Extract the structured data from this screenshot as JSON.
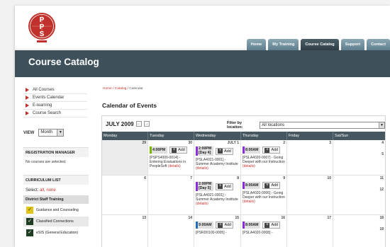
{
  "colors": {
    "accent_red": "#c0312b",
    "header_dark": "#3e515a",
    "nav_blue": "#6f8e9c",
    "green_marker": "#7ab800",
    "purple_marker": "#8a2be2",
    "blue_marker": "#1e6fb5"
  },
  "logo": {
    "letters": [
      "P",
      "P",
      "S"
    ]
  },
  "nav": {
    "tabs": [
      {
        "label": "Home",
        "active": false
      },
      {
        "label": "My Training",
        "active": false
      },
      {
        "label": "Course Catalog",
        "active": true
      },
      {
        "label": "Support",
        "active": false
      },
      {
        "label": "Contact",
        "active": false
      }
    ]
  },
  "page_title": "Course Catalog",
  "sidebar": {
    "menu": [
      "All Courses",
      "Events Calendar",
      "E-learning",
      "Course Search"
    ],
    "view_label": "VIEW",
    "view_value": "Month",
    "registration": {
      "title": "REGISTRATION MANAGER",
      "text": "No courses are selected."
    },
    "curriculum": {
      "title": "CURRICULUM LIST",
      "select_label": "Select:",
      "all": "all",
      "none": "none"
    },
    "group": "District Staff Training",
    "items": [
      "Guidance and Counseling",
      "Classified Connections",
      "eSIS (General Education)"
    ]
  },
  "breadcrumb": {
    "home": "Home",
    "sep": " / ",
    "catalog": "Catalog",
    "current": "Calendar"
  },
  "calendar": {
    "title": "Calendar of Events",
    "month": "JULY 2009",
    "prev_icon": "←",
    "next_icon": "→",
    "filter_label": "Filter by location:",
    "filter_value": "All locations",
    "days": [
      "Monday",
      "Tuesday",
      "Wednesday",
      "Thursday",
      "Friday",
      "Sat/Sun"
    ],
    "weeks": [
      {
        "nums": [
          "29",
          "30",
          "JULY 1",
          "2",
          "3",
          "4"
        ],
        "extra": "5"
      },
      {
        "nums": [
          "6",
          "7",
          "8",
          "9",
          "10",
          "11"
        ],
        "extra": "12"
      },
      {
        "nums": [
          "13",
          "14",
          "15",
          "16",
          "17",
          "18"
        ],
        "extra": "19"
      }
    ],
    "events": {
      "w1_tue": {
        "time": "4:00PM",
        "add": "Add",
        "desc": "[PSPS4000-0014] - Entering Evaluations in PeopleSoft",
        "details": "(details)"
      },
      "w1_wed": {
        "time1": "2:00PM",
        "time2": "[Day 4]",
        "add": "Add",
        "desc": "[PSLA4021-0001] - Summer Academy Institute",
        "details": "(details)"
      },
      "w1_thu": {
        "time": "8:00AM",
        "add": "Add",
        "desc": "[PSLA4020-0007] - Going Deeper with our Instruction",
        "details": "(details)"
      },
      "w2_wed": {
        "time1": "2:00PM",
        "time2": "[Day 5]",
        "add": "Add",
        "desc": "[PSLA4021-0001] - Summer Academy Institute",
        "details": "(details)"
      },
      "w2_thu": {
        "time": "8:00AM",
        "add": "Add",
        "desc": "[PSLA4020-0006] - Going Deeper with our Instruction",
        "details": "(details)"
      },
      "w3_wed": {
        "time": "9:00AM",
        "add": "Add",
        "desc": "[PSRD0100-0005] -"
      },
      "w3_thu": {
        "time": "8:00AM",
        "add": "Add",
        "desc": "[PSLA4020-0008] -"
      }
    }
  }
}
